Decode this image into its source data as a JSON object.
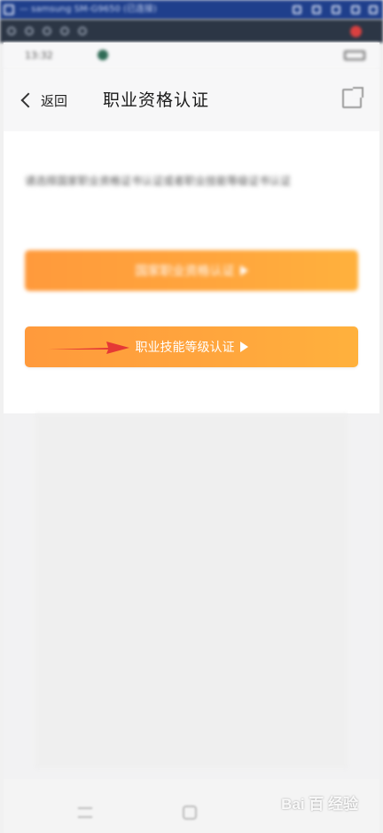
{
  "window": {
    "title": "— samsung SM-G9650 (已连接)"
  },
  "status": {
    "time": "13:32"
  },
  "nav": {
    "back_label": "返回",
    "title": "职业资格认证"
  },
  "content": {
    "description": "请选择国家职业资格证书认证或者职业技能等级证书认证",
    "btn_national_label": "国家职业资格认证",
    "btn_skill_label": "职业技能等级认证"
  },
  "colors": {
    "accent": "#ff9a3c",
    "arrow": "#e53935"
  },
  "watermark": {
    "brand": "Bai 百 经验"
  }
}
